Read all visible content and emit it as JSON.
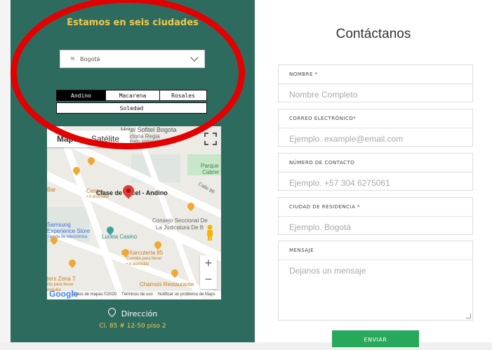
{
  "cities_panel": {
    "title": "Estamos en seis ciudades",
    "selected_city": "Bogotá",
    "tabs": [
      "Andino",
      "Macarena",
      "Rosales",
      "Soledad"
    ],
    "active_tab": "Andino"
  },
  "map": {
    "map_types": [
      "Mapa",
      "Satélite"
    ],
    "place_name": "Clase de Excel - Andino",
    "labels": {
      "hotel": "Hotel Sofitel Bogota",
      "hotel_sub1": "Victoria Regia",
      "hotel_sub2": "Cerrado temporalmente",
      "parque": "Parque",
      "cabrera": "Cabrer",
      "calle": "Calle 86",
      "bar": "Bar",
      "centro": "Centro",
      "domicilio": "• A domicilio",
      "consejo1": "Consejo Seccional De",
      "consejo2": "La Judicatura De B",
      "samsung1": "Samsung",
      "samsung2": "Experience Store",
      "samsung3": "Tienda de electrónica",
      "luckia": "Luckia Casino",
      "xarcuteria": "La Xarcutería 85",
      "xarc_sub1": "Comida para llevar",
      "xarc_sub2": "• A domicilio",
      "zona1": "ters Zona T",
      "zona2": "ida para llevar",
      "zona3": "omicilio",
      "chamois": "Chamois Restaurante"
    },
    "attribution": [
      "Datos de mapas ©2020",
      "Términos de uso",
      "Notificar un problema de Maps"
    ],
    "google": "Google"
  },
  "address": {
    "label": "Dirección",
    "value": "Cl. 85 # 12-50 piso 2"
  },
  "contact": {
    "title": "Contáctanos",
    "fields": [
      {
        "label": "NOMBRE *",
        "placeholder": "Nombre Completo"
      },
      {
        "label": "CORREO ELECTRÓNICO*",
        "placeholder": "Ejemplo. example@email.com"
      },
      {
        "label": "NÚMERO DE CONTACTO",
        "placeholder": "Ejemplo. +57 304 6275061"
      },
      {
        "label": "CIUDAD DE RESIDENCIA *",
        "placeholder": "Ejemplo. Bogotá"
      },
      {
        "label": "MENSAJE",
        "placeholder": "Dejanos un mensaje"
      }
    ],
    "submit": "ENVIAR"
  },
  "colors": {
    "panel_green": "#2e6b5f",
    "accent_yellow": "#f2c94c",
    "button_green": "#28a85a",
    "highlight_red": "#e30000"
  }
}
